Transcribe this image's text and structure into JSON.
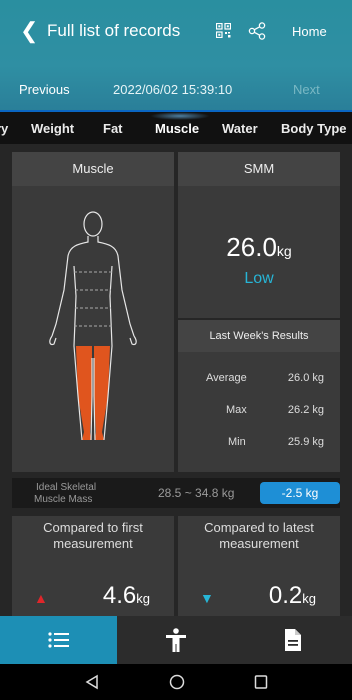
{
  "header": {
    "title": "Full list of records",
    "home_label": "Home",
    "previous_label": "Previous",
    "datetime": "2022/06/02 15:39:10",
    "next_label": "Next"
  },
  "tabs": [
    "ry",
    "Weight",
    "Fat",
    "Muscle",
    "Water",
    "Body Type"
  ],
  "active_tab": "Muscle",
  "muscle_panel": {
    "title": "Muscle"
  },
  "smm": {
    "title": "SMM",
    "value": "26.0",
    "unit": "kg",
    "status": "Low"
  },
  "last_week": {
    "title": "Last Week's Results",
    "average_label": "Average",
    "average_value": "26.0 kg",
    "max_label": "Max",
    "max_value": "26.2 kg",
    "min_label": "Min",
    "min_value": "25.9 kg"
  },
  "ideal": {
    "label_line1": "Ideal Skeletal",
    "label_line2": "Muscle Mass",
    "range": "28.5 ~ 34.8  kg",
    "difference": "-2.5 kg"
  },
  "compare_first": {
    "title_line1": "Compared to first",
    "title_line2": "measurement",
    "value": "4.6",
    "unit": "kg"
  },
  "compare_latest": {
    "title_line1": "Compared to latest",
    "title_line2": "measurement",
    "value": "0.2",
    "unit": "kg"
  },
  "colors": {
    "accent": "#1d8fb5",
    "low_status": "#27b5d6",
    "up_arrow": "#e0262a",
    "down_arrow": "#27b5d6",
    "muscle_fill": "#e0551e"
  }
}
